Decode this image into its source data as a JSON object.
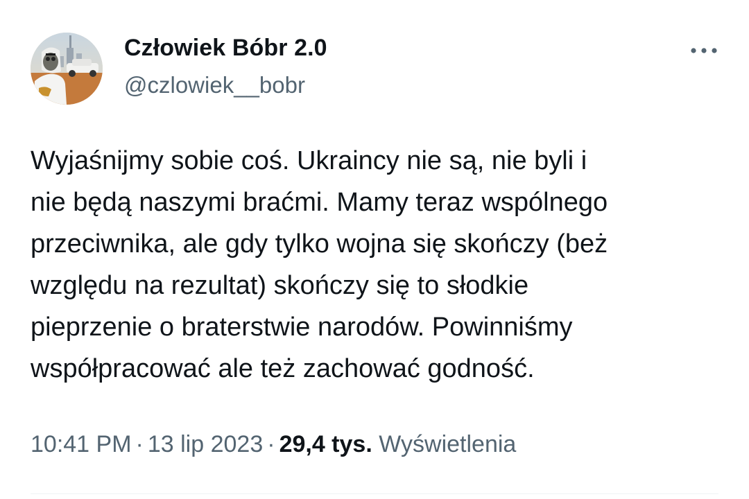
{
  "author": {
    "display_name": "Człowiek Bóbr 2.0",
    "handle": "@czlowiek__bobr"
  },
  "tweet": {
    "text_lines": [
      "Wyjaśnijmy sobie coś. Ukraincy nie są, nie byli i",
      "nie będą naszymi braćmi. Mamy teraz wspólnego",
      "przeciwnika, ale gdy tylko wojna się skończy (beż",
      "względu na rezultat) skończy się to słodkie",
      "pieprzenie o braterstwie narodów. Powinniśmy",
      "współpracować ale też zachować godność."
    ]
  },
  "meta": {
    "time": "10:41 PM",
    "separator": "·",
    "date": "13 lip 2023",
    "views_count": "29,4 tys.",
    "views_label": "Wyświetlenia"
  },
  "icons": {
    "more": "more-horizontal-icon",
    "avatar": "avatar-image"
  },
  "colors": {
    "text_primary": "#0f1419",
    "text_secondary": "#536471",
    "divider": "#eff3f4",
    "background": "#ffffff"
  }
}
